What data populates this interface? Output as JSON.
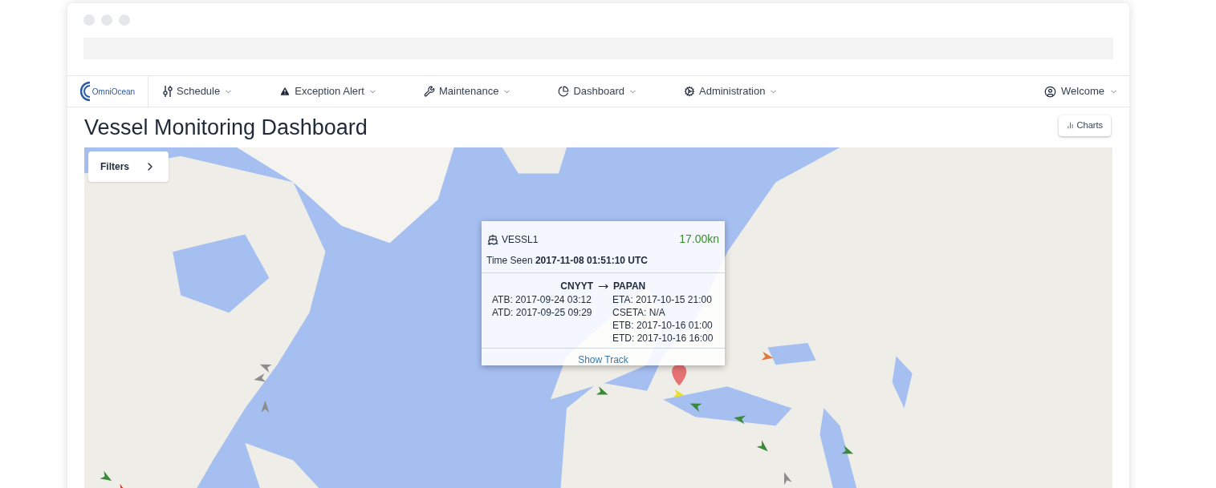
{
  "brand": {
    "name": "OmniOcean"
  },
  "nav": [
    {
      "label": "Schedule"
    },
    {
      "label": "Exception Alert"
    },
    {
      "label": "Maintenance"
    },
    {
      "label": "Dashboard"
    },
    {
      "label": "Administration"
    }
  ],
  "user_menu": {
    "label": "Welcome"
  },
  "page_title": "Vessel Monitoring Dashboard",
  "charts_button": {
    "label": "Charts"
  },
  "map": {
    "filters_button": {
      "label": "Filters"
    },
    "popup": {
      "vessel": "VESSL1",
      "speed": "17.00kn",
      "time_seen_label": "Time Seen",
      "time_seen": "2017-11-08 01:51:10 UTC",
      "origin": "CNYYT",
      "destination": "PAPAN",
      "left_times": [
        "ATB: 2017-09-24 03:12",
        "ATD: 2017-09-25 09:29"
      ],
      "right_times": [
        "ETA: 2017-10-15 21:00",
        "CSETA: N/A",
        "ETB: 2017-10-16 01:00",
        "ETD: 2017-10-16 16:00"
      ],
      "link": "Show Track"
    }
  }
}
